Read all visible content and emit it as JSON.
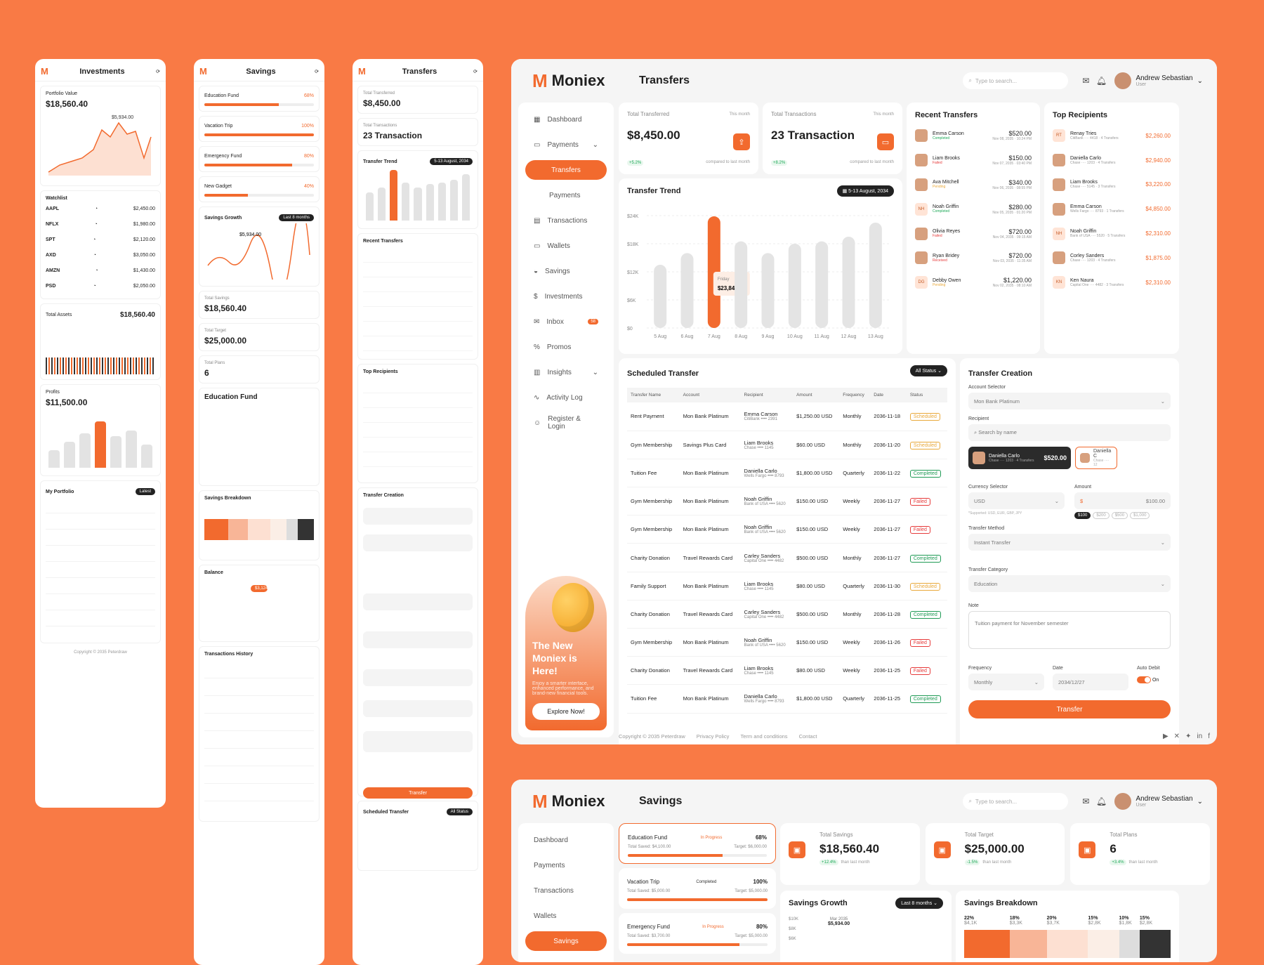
{
  "mobile_investments": {
    "title": "Investments",
    "portfolio_label": "Portfolio Value",
    "portfolio_value": "$18,560.40",
    "peak": "$5,934.00",
    "watchlist": "Watchlist",
    "total_assets_label": "Total Assets",
    "total_assets": "$18,560.40",
    "profits_label": "Profits",
    "profits_value": "$11,500.00",
    "my_portfolio": "My Portfolio",
    "latest": "Latest",
    "copyright": "Copyright © 2035 Peterdraw",
    "tickers": [
      "AAPL",
      "NFLX",
      "SPT",
      "AXD",
      "AMZN",
      "PSD"
    ],
    "prices": [
      "$2,450.00",
      "$1,980.00",
      "$2,120.00",
      "$3,050.00",
      "$1,430.00",
      "$2,050.00"
    ]
  },
  "mobile_savings": {
    "title": "Savings",
    "goals": [
      {
        "name": "Education Fund",
        "pct": "68%",
        "fill": 0.68
      },
      {
        "name": "Vacation Trip",
        "pct": "100%",
        "fill": 1
      },
      {
        "name": "Emergency Fund",
        "pct": "80%",
        "fill": 0.8
      },
      {
        "name": "New Gadget",
        "pct": "40%",
        "fill": 0.4
      }
    ],
    "growth": "Savings Growth",
    "last8": "Last 8 months",
    "peak": "$5,934.00",
    "total_savings_label": "Total Savings",
    "total_savings": "$18,560.40",
    "total_target_label": "Total Target",
    "total_target": "$25,000.00",
    "total_plans_label": "Total Plans",
    "total_plans": "6",
    "edu_title": "Education Fund",
    "breakdown": "Savings Breakdown",
    "balance": "Balance",
    "balance_peak": "$3,124",
    "history": "Transactions History"
  },
  "mobile_transfers": {
    "title": "Transfers",
    "total_label": "Total Transferred",
    "total": "$8,450.00",
    "tx_label": "Total Transactions",
    "tx": "23 Transaction",
    "trend": "Transfer Trend",
    "trend_date": "5-13 August, 2034",
    "tooltip": "$23,844.00",
    "recent": "Recent Transfers",
    "top": "Top Recipients",
    "creation": "Transfer Creation",
    "transfer_btn": "Transfer",
    "scheduled": "Scheduled Transfer",
    "all_status": "All Status"
  },
  "header": {
    "brand": "Moniex",
    "page_title": "Transfers",
    "search_placeholder": "Type to search...",
    "user_name": "Andrew Sebastian",
    "user_role": "User"
  },
  "sidebar": {
    "items": [
      {
        "label": "Dashboard",
        "icon": "grid-icon"
      },
      {
        "label": "Payments",
        "icon": "wallet-icon"
      },
      {
        "label": "Transfers",
        "active": true
      },
      {
        "label": "Payments",
        "sub": true
      },
      {
        "label": "Transactions",
        "icon": "receipt-icon"
      },
      {
        "label": "Wallets",
        "icon": "wallet-icon"
      },
      {
        "label": "Savings",
        "icon": "piggy-icon"
      },
      {
        "label": "Investments",
        "icon": "dollar-icon"
      },
      {
        "label": "Inbox",
        "icon": "inbox-icon",
        "badge": "58"
      },
      {
        "label": "Promos",
        "icon": "percent-icon"
      },
      {
        "label": "Insights",
        "icon": "chart-icon"
      },
      {
        "label": "Activity Log",
        "icon": "activity-icon"
      },
      {
        "label": "Register & Login",
        "icon": "user-icon"
      }
    ],
    "promo_title": "The New Moniex is Here!",
    "promo_text": "Enjoy a smarter interface, enhanced performance, and brand-new financial tools.",
    "promo_button": "Explore Now!"
  },
  "kpis": {
    "total": {
      "label": "Total Transferred",
      "period": "This month",
      "value": "$8,450.00",
      "delta": "+5.2%",
      "note": "compared to last month"
    },
    "tx": {
      "label": "Total Transactions",
      "period": "This month",
      "value": "23 Transaction",
      "delta": "+8.2%",
      "note": "compared to last month"
    }
  },
  "trend": {
    "title": "Transfer Trend",
    "range": "5-13 August, 2034",
    "tooltip_day": "Friday",
    "tooltip_value": "$23,844.00"
  },
  "chart_data": {
    "type": "bar",
    "categories": [
      "5 Aug",
      "6 Aug",
      "7 Aug",
      "8 Aug",
      "9 Aug",
      "10 Aug",
      "11 Aug",
      "12 Aug",
      "13 Aug"
    ],
    "values": [
      13500,
      16000,
      23844,
      18500,
      16000,
      18000,
      18500,
      19500,
      22500
    ],
    "highlight": "7 Aug",
    "yticks": [
      "$0",
      "$6K",
      "$12K",
      "$18K",
      "$24K"
    ],
    "ylim": [
      0,
      24000
    ],
    "color_bar": "#e4e4e4",
    "color_highlight": "#f26a2e"
  },
  "recent": {
    "title": "Recent Transfers",
    "items": [
      {
        "name": "Emma Carson",
        "status": "Completed",
        "amount": "$520.00",
        "date": "Nov 08, 2035 · 10:24 PM"
      },
      {
        "name": "Liam Brooks",
        "status": "Failed",
        "amount": "$150.00",
        "date": "Nov 07, 2035 · 03:40 PM"
      },
      {
        "name": "Ava Mitchell",
        "status": "Pending",
        "amount": "$340.00",
        "date": "Nov 06, 2035 · 08:55 PM"
      },
      {
        "name": "Noah Griffin",
        "status": "Completed",
        "amount": "$280.00",
        "date": "Nov 05, 2035 · 01:20 PM",
        "initials": "NH"
      },
      {
        "name": "Olivia Reyes",
        "status": "Failed",
        "amount": "$720.00",
        "date": "Nov 04, 2035 · 09:15 AM"
      },
      {
        "name": "Ryan Bridey",
        "status": "Received",
        "amount": "$720.00",
        "date": "Nov 03, 2035 · 11:35 AM"
      },
      {
        "name": "Debby Owen",
        "status": "Pending",
        "amount": "$1,220.00",
        "date": "Nov 02, 2035 · 08:10 AM",
        "initials": "DG"
      }
    ]
  },
  "top": {
    "title": "Top Recipients",
    "items": [
      {
        "name": "Renay Tries",
        "sub": "CitiBank ···· 4418 · 4 Transfers",
        "amount": "$2,260.00",
        "initials": "RT"
      },
      {
        "name": "Daniella Carlo",
        "sub": "Chase ···· 1203 · 4 Transfers",
        "amount": "$2,940.00"
      },
      {
        "name": "Liam Brooks",
        "sub": "Chase ···· 5145 · 3 Transfers",
        "amount": "$3,220.00"
      },
      {
        "name": "Emma Carson",
        "sub": "Wells Fargo ···· 8793 · 1 Transfers",
        "amount": "$4,850.00"
      },
      {
        "name": "Noah Griffin",
        "sub": "Bank of USA ···· 5520 · 5 Transfers",
        "amount": "$2,310.00",
        "initials": "NH"
      },
      {
        "name": "Corley Sanders",
        "sub": "Chase ···· 1203 · 4 Transfers",
        "amount": "$1,875.00"
      },
      {
        "name": "Ken Naura",
        "sub": "Capital One ···· 4482 · 3 Transfers",
        "amount": "$2,310.00",
        "initials": "KN"
      }
    ]
  },
  "scheduled": {
    "title": "Scheduled Transfer",
    "filter": "All Status",
    "headers": [
      "Transfer Name",
      "Account",
      "Recipient",
      "Amount",
      "Frequency",
      "Date",
      "Status"
    ],
    "rows": [
      [
        "Rent Payment",
        "Mon Bank Platinum",
        "Emma Carson",
        "CitiBank •••• 2391",
        "$1,250.00 USD",
        "Monthly",
        "2036-11-18",
        "Scheduled"
      ],
      [
        "Gym Membership",
        "Savings Plus Card",
        "Liam Brooks",
        "Chase •••• 1145",
        "$60.00 USD",
        "Monthly",
        "2036-11-20",
        "Scheduled"
      ],
      [
        "Tuition Fee",
        "Mon Bank Platinum",
        "Daniella Carlo",
        "Wells Fargo •••• 8793",
        "$1,800.00 USD",
        "Quarterly",
        "2036-11-22",
        "Completed"
      ],
      [
        "Gym Membership",
        "Mon Bank Platinum",
        "Noah Griffin",
        "Bank of USA •••• 5620",
        "$150.00 USD",
        "Weekly",
        "2036-11-27",
        "Failed"
      ],
      [
        "Gym Membership",
        "Mon Bank Platinum",
        "Noah Griffin",
        "Bank of USA •••• 5620",
        "$150.00 USD",
        "Weekly",
        "2036-11-27",
        "Failed"
      ],
      [
        "Charity Donation",
        "Travel Rewards Card",
        "Carley Sanders",
        "Capital One •••• 4482",
        "$500.00 USD",
        "Monthly",
        "2036-11-27",
        "Completed"
      ],
      [
        "Family Support",
        "Mon Bank Platinum",
        "Liam Brooks",
        "Chase •••• 1145",
        "$80.00 USD",
        "Quarterly",
        "2036-11-30",
        "Scheduled"
      ],
      [
        "Charity Donation",
        "Travel Rewards Card",
        "Carley Sanders",
        "Capital One •••• 4482",
        "$500.00 USD",
        "Monthly",
        "2036-11-28",
        "Completed"
      ],
      [
        "Gym Membership",
        "Mon Bank Platinum",
        "Noah Griffin",
        "Bank of USA •••• 5620",
        "$150.00 USD",
        "Weekly",
        "2036-11-26",
        "Failed"
      ],
      [
        "Charity Donation",
        "Travel Rewards Card",
        "Liam Brooks",
        "Chase •••• 1145",
        "$80.00 USD",
        "Weekly",
        "2036-11-25",
        "Failed"
      ],
      [
        "Tuition Fee",
        "Mon Bank Platinum",
        "Daniella Carlo",
        "Wells Fargo •••• 8793",
        "$1,800.00 USD",
        "Quarterly",
        "2036-11-25",
        "Completed"
      ]
    ]
  },
  "creation": {
    "title": "Transfer Creation",
    "account_label": "Account Selector",
    "account_value": "Mon Bank Platinum",
    "recipient_label": "Recipient",
    "recipient_placeholder": "Search by name",
    "selected_name": "Daniella Carlo",
    "selected_sub": "Chase ···· 1203 · 4 Transfers",
    "selected_amount": "$520.00",
    "second_name": "Daniella C",
    "second_sub": "Chase ···· 12",
    "currency_label": "Currency Selector",
    "currency_value": "USD",
    "currency_note": "*Supported: USD, EUR, GBP, JPY",
    "amount_label": "Amount",
    "amount_value": "$100.00",
    "quick": [
      "$100",
      "$200",
      "$500",
      "$1,000"
    ],
    "method_label": "Transfer Method",
    "method_value": "Instant Transfer",
    "category_label": "Transfer Category",
    "category_value": "Education",
    "note_label": "Note",
    "note_value": "Tuition payment for November semester",
    "frequency_label": "Frequency",
    "frequency_value": "Monthly",
    "date_label": "Date",
    "date_value": "2034/12/27",
    "autodebit_label": "Auto Debit",
    "autodebit_value": "On",
    "button": "Transfer"
  },
  "footer": {
    "copyright": "Copyright © 2035 Peterdraw",
    "links": [
      "Privacy Policy",
      "Term and conditions",
      "Contact"
    ]
  },
  "savings_page": {
    "title": "Savings",
    "sidebar": [
      "Dashboard",
      "Payments",
      "Transactions",
      "Wallets",
      "Savings"
    ],
    "goals": [
      {
        "name": "Education Fund",
        "status": "In Progress",
        "pct": "68%",
        "saved": "Total Saved: $4,100.00",
        "target": "Target: $6,000.00",
        "fill": 0.68
      },
      {
        "name": "Vacation Trip",
        "status": "Completed",
        "pct": "100%",
        "saved": "Total Saved: $5,000.00",
        "target": "Target: $5,000.00",
        "fill": 1
      },
      {
        "name": "Emergency Fund",
        "status": "In Progress",
        "pct": "80%",
        "saved": "Total Saved: $3,700.00",
        "target": "Target: $5,000.00",
        "fill": 0.8
      }
    ],
    "kpis": [
      {
        "label": "Total Savings",
        "value": "$18,560.40",
        "delta": "+12.4%",
        "note": "than last month"
      },
      {
        "label": "Total Target",
        "value": "$25,000.00",
        "delta": "-1.5%",
        "note": "than last month"
      },
      {
        "label": "Total Plans",
        "value": "6",
        "delta": "+3.4%",
        "note": "than last month"
      }
    ],
    "growth_title": "Savings Growth",
    "growth_range": "Last 8 months",
    "growth_ticks": [
      "$10K",
      "$8K",
      "$6K"
    ],
    "growth_tooltip_month": "Mar 2035",
    "growth_tooltip_value": "$5,934.00",
    "breakdown_title": "Savings Breakdown",
    "breakdown": [
      {
        "pct": "22%",
        "amt": "$4,1K"
      },
      {
        "pct": "18%",
        "amt": "$3,3K"
      },
      {
        "pct": "20%",
        "amt": "$3,7K"
      },
      {
        "pct": "15%",
        "amt": "$2,8K"
      },
      {
        "pct": "10%",
        "amt": "$1,8K"
      },
      {
        "pct": "15%",
        "amt": "$2,8K"
      }
    ]
  }
}
